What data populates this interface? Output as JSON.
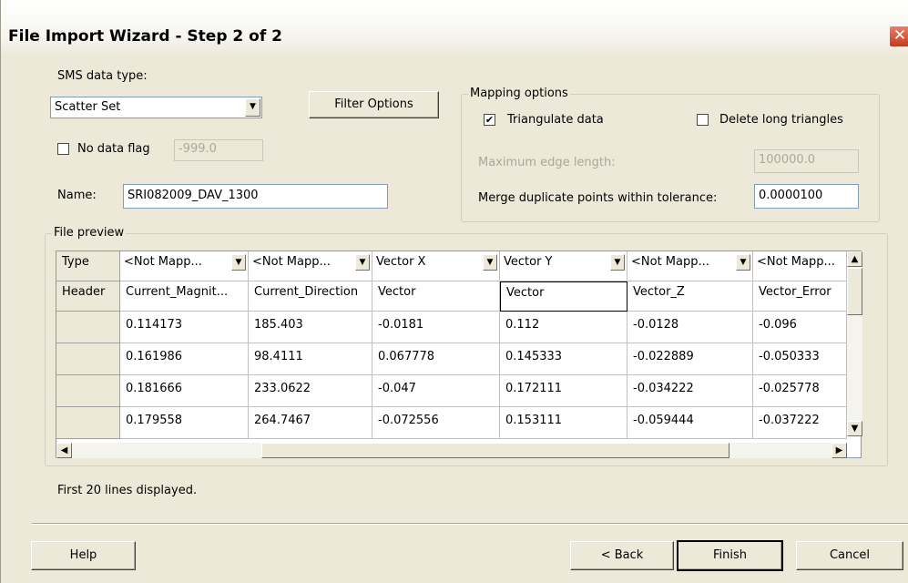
{
  "window": {
    "title": "File Import Wizard - Step 2 of 2",
    "close_glyph": "✕"
  },
  "data_type": {
    "label": "SMS data type:",
    "value": "Scatter Set"
  },
  "filter_button": "Filter Options",
  "no_data_flag": {
    "label": "No data flag",
    "checked": false,
    "value": "-999.0"
  },
  "name": {
    "label": "Name:",
    "value": "SRI082009_DAV_1300"
  },
  "mapping": {
    "legend": "Mapping options",
    "triangulate": {
      "label": "Triangulate data",
      "checked": true
    },
    "delete_long": {
      "label": "Delete long triangles",
      "checked": false
    },
    "max_edge": {
      "label": "Maximum edge length:",
      "value": "100000.0"
    },
    "merge": {
      "label": "Merge duplicate points within tolerance:",
      "value": "0.0000100"
    }
  },
  "preview": {
    "legend": "File preview",
    "type_label": "Type",
    "header_label": "Header",
    "type_row": [
      "<Not Mapp...",
      "<Not Mapp...",
      "Vector X",
      "Vector Y",
      "<Not Mapp...",
      "<Not Mapp..."
    ],
    "header_row": [
      "Current_Magnit...",
      "Current_Direction",
      "Vector",
      "Vector",
      "Vector_Z",
      "Vector_Error"
    ],
    "rows": [
      [
        "0.114173",
        "185.403",
        "-0.0181",
        "0.112",
        "-0.0128",
        "-0.096"
      ],
      [
        "0.161986",
        "98.4111",
        "0.067778",
        "0.145333",
        "-0.022889",
        "-0.050333"
      ],
      [
        "0.181666",
        "233.0622",
        "-0.047",
        "0.172111",
        "-0.034222",
        "-0.025778"
      ],
      [
        "0.179558",
        "264.7467",
        "-0.072556",
        "0.153111",
        "-0.059444",
        "-0.037222"
      ]
    ],
    "status": "First 20 lines displayed."
  },
  "buttons": {
    "help": "Help",
    "back": "< Back",
    "finish": "Finish",
    "cancel": "Cancel"
  },
  "icons": {
    "dropdown": "▼",
    "up": "▲",
    "down": "▼",
    "left": "◀",
    "right": "▶",
    "check": "✔"
  }
}
